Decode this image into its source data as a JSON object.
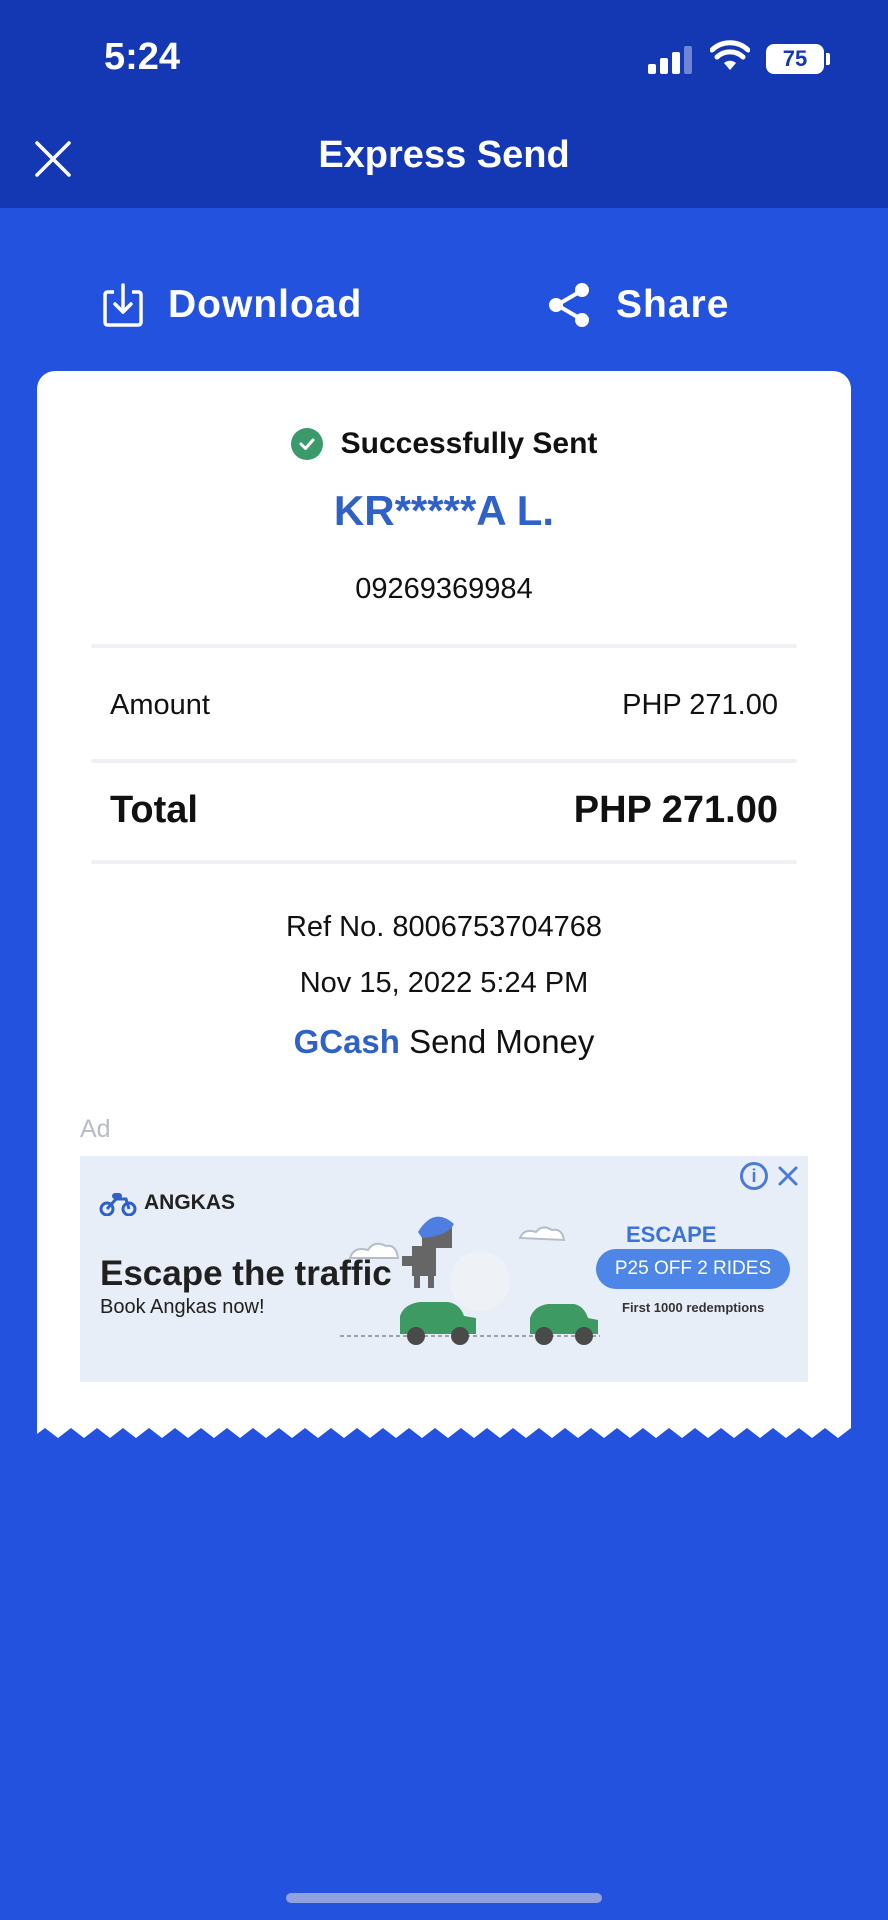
{
  "status_bar": {
    "time": "5:24",
    "battery": "75"
  },
  "header": {
    "title": "Express Send"
  },
  "actions": {
    "download_label": "Download",
    "share_label": "Share"
  },
  "receipt": {
    "status": "Successfully Sent",
    "recipient": "KR*****A L.",
    "phone": "09269369984",
    "amount_label": "Amount",
    "amount_value": "PHP 271.00",
    "total_label": "Total",
    "total_value": "PHP 271.00",
    "ref": "Ref No. 8006753704768",
    "date": "Nov 15, 2022 5:24 PM",
    "brand": "GCash",
    "service": "Send Money"
  },
  "ad": {
    "label": "Ad",
    "brand": "ANGKAS",
    "headline": "Escape the traffic",
    "subline": "Book Angkas now!",
    "promo_head": "ESCAPE",
    "promo_pill": "P25 OFF 2 RIDES",
    "promo_note": "First 1000 redemptions"
  },
  "colors": {
    "background": "#2352DE",
    "header": "#1438B4",
    "accent": "#2F61C6",
    "success": "#3A9A6B"
  }
}
